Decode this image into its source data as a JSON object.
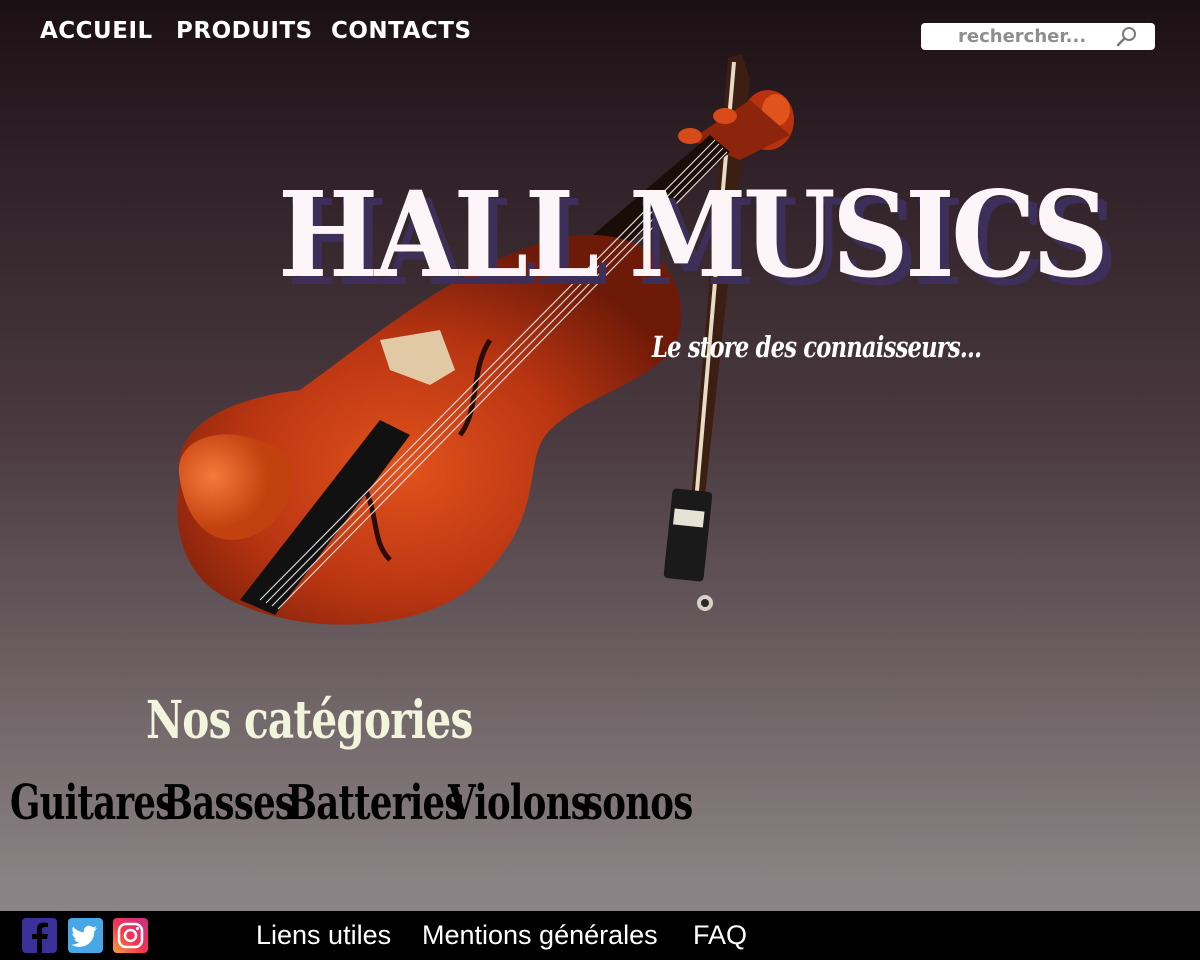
{
  "nav": {
    "items": [
      {
        "label": "ACCUEIL"
      },
      {
        "label": "PRODUITS"
      },
      {
        "label": "CONTACTS"
      }
    ]
  },
  "search": {
    "placeholder": "rechercher...",
    "icon": "search-icon"
  },
  "hero": {
    "title": "HALL MUSICS",
    "tagline": "Le store des connaisseurs...",
    "image": "violin-illustration"
  },
  "categories": {
    "title": "Nos catégories",
    "items": [
      {
        "label": "Guitares"
      },
      {
        "label": "Basses"
      },
      {
        "label": "Batteries"
      },
      {
        "label": "Violons"
      },
      {
        "label": "sonos"
      }
    ]
  },
  "footer": {
    "social": [
      {
        "icon": "facebook-icon"
      },
      {
        "icon": "twitter-icon"
      },
      {
        "icon": "instagram-icon"
      }
    ],
    "links": [
      {
        "label": "Liens utiles"
      },
      {
        "label": "Mentions générales"
      },
      {
        "label": "FAQ"
      }
    ]
  },
  "colors": {
    "title": "#fdf5f7",
    "title_shadow": "#3e2f5a",
    "categories_title": "#f2f4dc",
    "footer_bg": "#000000"
  }
}
